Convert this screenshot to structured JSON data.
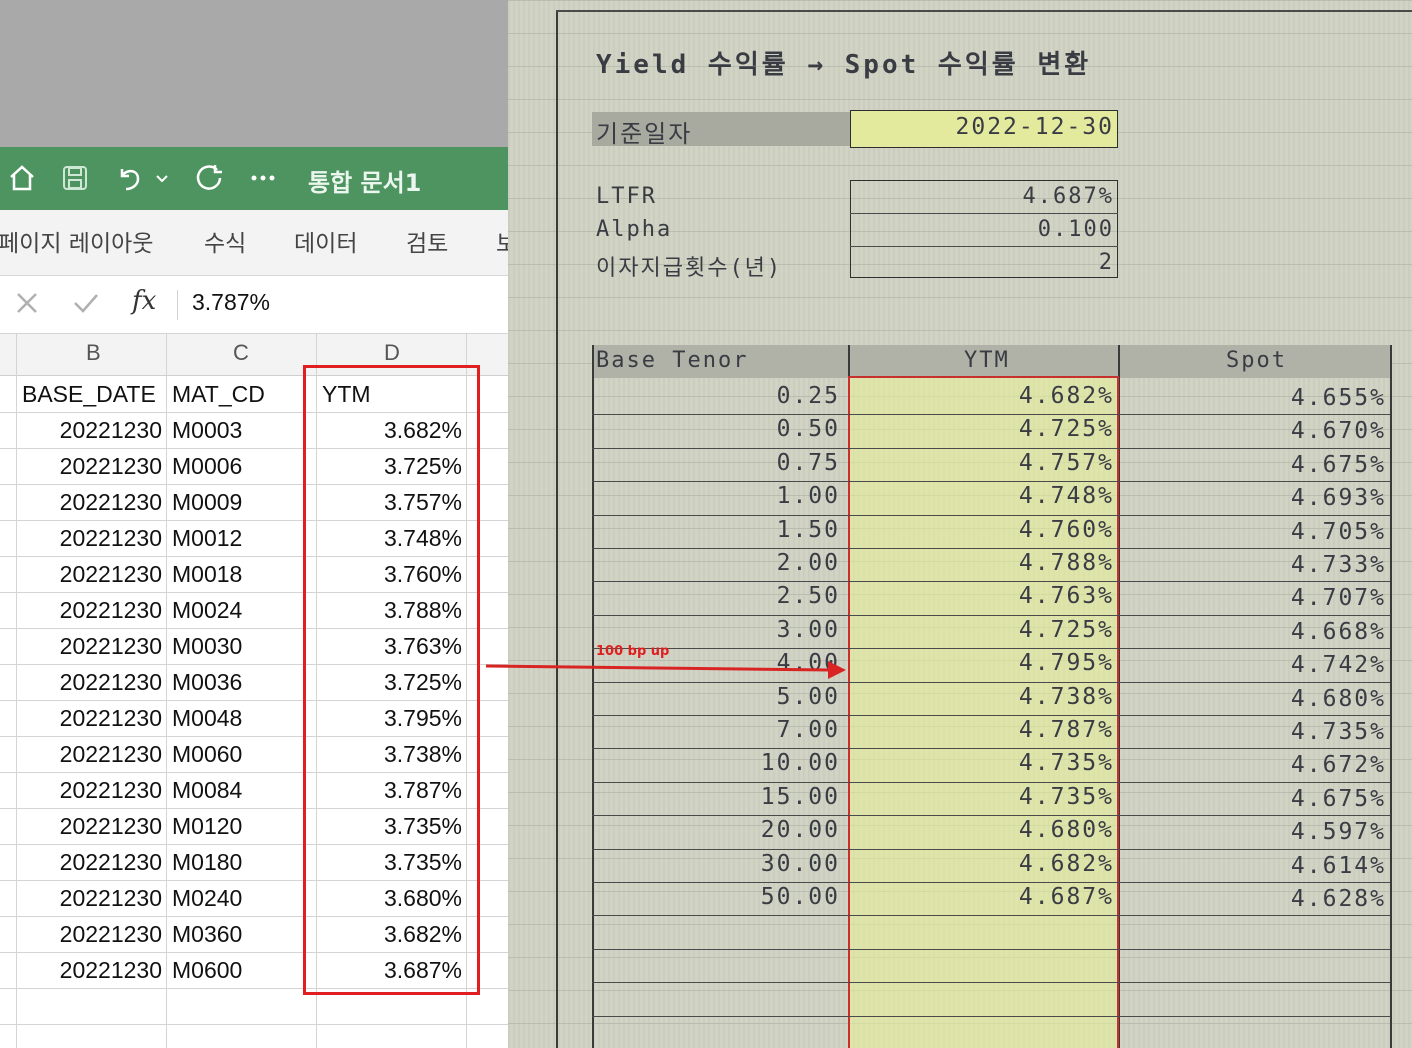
{
  "excel": {
    "doc_title": "통합 문서1",
    "ribbon_tabs": [
      "페이지 레이아웃",
      "수식",
      "데이터",
      "검토",
      "보"
    ],
    "formula_value": "3.787%",
    "fx_label": "fx",
    "columns": [
      "B",
      "C",
      "D"
    ],
    "header_row": {
      "b": "BASE_DATE",
      "c": "MAT_CD",
      "d": "YTM"
    },
    "rows": [
      {
        "b": "20221230",
        "c": "M0003",
        "d": "3.682%"
      },
      {
        "b": "20221230",
        "c": "M0006",
        "d": "3.725%"
      },
      {
        "b": "20221230",
        "c": "M0009",
        "d": "3.757%"
      },
      {
        "b": "20221230",
        "c": "M0012",
        "d": "3.748%"
      },
      {
        "b": "20221230",
        "c": "M0018",
        "d": "3.760%"
      },
      {
        "b": "20221230",
        "c": "M0024",
        "d": "3.788%"
      },
      {
        "b": "20221230",
        "c": "M0030",
        "d": "3.763%"
      },
      {
        "b": "20221230",
        "c": "M0036",
        "d": "3.725%"
      },
      {
        "b": "20221230",
        "c": "M0048",
        "d": "3.795%"
      },
      {
        "b": "20221230",
        "c": "M0060",
        "d": "3.738%"
      },
      {
        "b": "20221230",
        "c": "M0084",
        "d": "3.787%"
      },
      {
        "b": "20221230",
        "c": "M0120",
        "d": "3.735%"
      },
      {
        "b": "20221230",
        "c": "M0180",
        "d": "3.735%"
      },
      {
        "b": "20221230",
        "c": "M0240",
        "d": "3.680%"
      },
      {
        "b": "20221230",
        "c": "M0360",
        "d": "3.682%"
      },
      {
        "b": "20221230",
        "c": "M0600",
        "d": "3.687%"
      }
    ],
    "icons": [
      "home-icon",
      "save-icon",
      "undo-icon",
      "chevron-down-icon",
      "redo-icon",
      "more-icon",
      "cancel-icon",
      "check-icon"
    ]
  },
  "photo": {
    "title": "Yield 수익률 → Spot 수익률 변환",
    "base_date_label": "기준일자",
    "base_date_value": "2022-12-30",
    "params": [
      {
        "label": "LTFR",
        "value": "4.687%"
      },
      {
        "label": "Alpha",
        "value": "0.100"
      },
      {
        "label": "이자지급횟수(년)",
        "value": "2"
      }
    ],
    "table_headers": {
      "tenor": "Base Tenor",
      "ytm": "YTM",
      "spot": "Spot"
    },
    "table_rows": [
      {
        "tenor": "0.25",
        "ytm": "4.682%",
        "spot": "4.655%"
      },
      {
        "tenor": "0.50",
        "ytm": "4.725%",
        "spot": "4.670%"
      },
      {
        "tenor": "0.75",
        "ytm": "4.757%",
        "spot": "4.675%"
      },
      {
        "tenor": "1.00",
        "ytm": "4.748%",
        "spot": "4.693%"
      },
      {
        "tenor": "1.50",
        "ytm": "4.760%",
        "spot": "4.705%"
      },
      {
        "tenor": "2.00",
        "ytm": "4.788%",
        "spot": "4.733%"
      },
      {
        "tenor": "2.50",
        "ytm": "4.763%",
        "spot": "4.707%"
      },
      {
        "tenor": "3.00",
        "ytm": "4.725%",
        "spot": "4.668%"
      },
      {
        "tenor": "4.00",
        "ytm": "4.795%",
        "spot": "4.742%"
      },
      {
        "tenor": "5.00",
        "ytm": "4.738%",
        "spot": "4.680%"
      },
      {
        "tenor": "7.00",
        "ytm": "4.787%",
        "spot": "4.735%"
      },
      {
        "tenor": "10.00",
        "ytm": "4.735%",
        "spot": "4.672%"
      },
      {
        "tenor": "15.00",
        "ytm": "4.735%",
        "spot": "4.675%"
      },
      {
        "tenor": "20.00",
        "ytm": "4.680%",
        "spot": "4.597%"
      },
      {
        "tenor": "30.00",
        "ytm": "4.682%",
        "spot": "4.614%"
      },
      {
        "tenor": "50.00",
        "ytm": "4.687%",
        "spot": "4.628%"
      }
    ]
  },
  "annotation": {
    "arrow_label": "100 bp up",
    "color": "#e02020"
  },
  "colors": {
    "excel_green": "#4e9460",
    "highlight_red": "#e02020",
    "photo_yellow": "#e8f296"
  }
}
